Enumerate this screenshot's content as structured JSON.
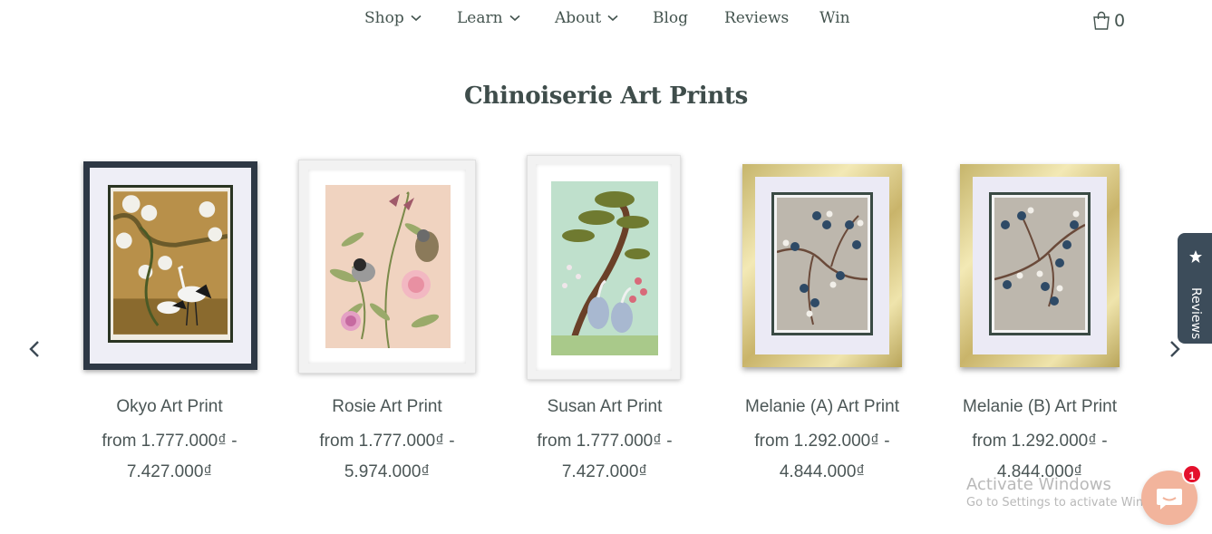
{
  "nav": {
    "items": [
      {
        "label": "Shop",
        "dropdown": true
      },
      {
        "label": "Learn",
        "dropdown": true
      },
      {
        "label": "About",
        "dropdown": true
      },
      {
        "label": "Blog",
        "dropdown": false
      },
      {
        "label": "Reviews",
        "dropdown": false
      },
      {
        "label": "Win",
        "dropdown": false
      }
    ],
    "cart_count": "0"
  },
  "section": {
    "title": "Chinoiserie Art Prints"
  },
  "products": [
    {
      "name": "Okyo Art Print",
      "price_from": "from 1.777.000₫ -",
      "price_to": "7.427.000₫",
      "frame": "dark"
    },
    {
      "name": "Rosie Art Print",
      "price_from": "from 1.777.000₫ -",
      "price_to": "5.974.000₫",
      "frame": "white"
    },
    {
      "name": "Susan Art Print",
      "price_from": "from 1.777.000₫ -",
      "price_to": "7.427.000₫",
      "frame": "white"
    },
    {
      "name": "Melanie (A) Art Print",
      "price_from": "from 1.292.000₫ -",
      "price_to": "4.844.000₫",
      "frame": "gold"
    },
    {
      "name": "Melanie (B) Art Print",
      "price_from": "from 1.292.000₫ -",
      "price_to": "4.844.000₫",
      "frame": "gold"
    }
  ],
  "reviews_tab": {
    "label": "Reviews"
  },
  "activate_windows": {
    "title": "Activate Windows",
    "subtitle": "Go to Settings to activate Windows."
  },
  "chat": {
    "badge": "1"
  },
  "icons": {
    "cart": "shopping-bag-icon",
    "prev": "chevron-left-icon",
    "next": "chevron-right-icon",
    "reviews": "star-icon",
    "chat": "chat-bubble-icon"
  },
  "colors": {
    "text": "#44544f",
    "reviews_tab": "#3c4c5a",
    "chat_button": "#f2b49c",
    "badge": "#e4102c"
  }
}
